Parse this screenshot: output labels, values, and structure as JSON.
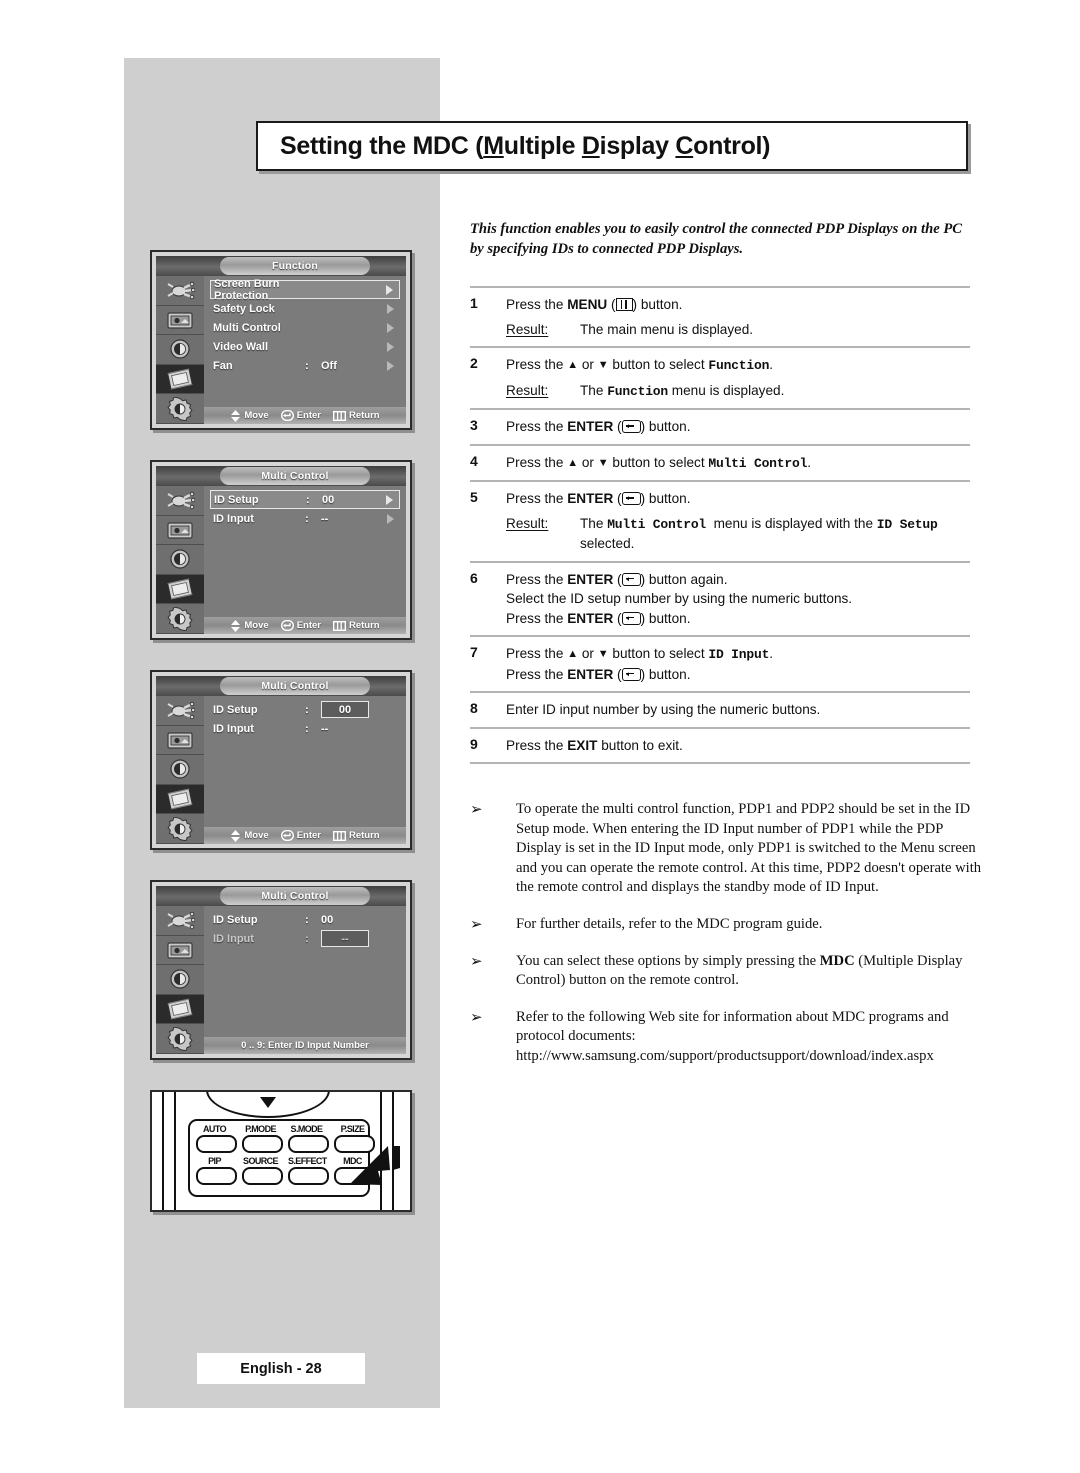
{
  "title": "Setting the MDC (Multiple Display Control)",
  "title_parts": [
    {
      "t": "Setting the MDC (",
      "u": false
    },
    {
      "t": "M",
      "u": true
    },
    {
      "t": "ultiple ",
      "u": false
    },
    {
      "t": "D",
      "u": true
    },
    {
      "t": "isplay ",
      "u": false
    },
    {
      "t": "C",
      "u": true
    },
    {
      "t": "ontrol)",
      "u": false
    }
  ],
  "intro": "This function enables you to easily control the connected PDP Displays on the PC by specifying IDs to connected PDP Displays.",
  "result_label": "Result:",
  "steps": [
    {
      "num": "1",
      "lines": [
        "Press the <b>MENU</b> (<span class='menu-glyph'><i></i><i></i></span>) button."
      ],
      "result": "The main menu is displayed."
    },
    {
      "num": "2",
      "lines": [
        "Press the <span class='arr'>▲</span> or <span class='arr'>▼</span> button to select <span class='mono'>Function</span>."
      ],
      "result": "The <span class='mono'>Function</span> menu is displayed."
    },
    {
      "num": "3",
      "lines": [
        "Press the <b>ENTER</b> (<span class='enter-glyph'></span>) button."
      ],
      "result": null
    },
    {
      "num": "4",
      "lines": [
        "Press the <span class='arr'>▲</span> or <span class='arr'>▼</span> button to select <span class='mono'>Multi Control</span>."
      ],
      "result": null
    },
    {
      "num": "5",
      "lines": [
        "Press the <b>ENTER</b> (<span class='enter-glyph'></span>) button."
      ],
      "result": "The <span class='mono'>Multi Control</span>&nbsp; menu is displayed with the <span class='mono'>ID Setup</span> selected."
    },
    {
      "num": "6",
      "lines": [
        "Press the <b>ENTER</b> (<span class='enter-glyph'></span>) button again.",
        "Select the ID setup number by using the numeric buttons.",
        "Press the <b>ENTER</b> (<span class='enter-glyph'></span>) button."
      ],
      "result": null
    },
    {
      "num": "7",
      "lines": [
        "Press the <span class='arr'>▲</span> or <span class='arr'>▼</span> button to select <span class='mono'>ID Input</span>.",
        "Press the <b>ENTER</b> (<span class='enter-glyph'></span>) button."
      ],
      "result": null
    },
    {
      "num": "8",
      "lines": [
        "Enter ID input number by using the numeric buttons."
      ],
      "result": null
    },
    {
      "num": "9",
      "lines": [
        "Press the <b>EXIT</b> button to exit."
      ],
      "result": null
    }
  ],
  "notes": [
    {
      "bullet": "➢",
      "html": "To operate the multi control function, PDP1 and PDP2 should be set in the ID Setup mode. When entering the ID Input number of PDP1 while the PDP Display is set in the ID Input mode, only PDP1 is switched to the Menu screen and you can operate the remote control. At this time, PDP2 doesn't operate with the remote control and displays the standby mode of ID Input."
    },
    {
      "bullet": "➢",
      "html": "For further details, refer to the MDC program guide."
    },
    {
      "bullet": "➢",
      "html": "You can select these options by simply pressing the <b>MDC</b> (Multiple Display Control) button on the remote control."
    },
    {
      "bullet": "➢",
      "html": "Refer to the following Web site for information about MDC programs and protocol documents: http://www.samsung.com/support/productsupport/download/index.aspx"
    }
  ],
  "osd_panels": [
    {
      "tab": "Function",
      "active_icon": 3,
      "items": [
        {
          "label": "Screen Burn Protection",
          "colon": "",
          "value": "",
          "selected": true,
          "arrow": true,
          "arrow_lit": true,
          "dim": false,
          "boxed": false
        },
        {
          "label": "Safety Lock",
          "colon": "",
          "value": "",
          "selected": false,
          "arrow": true,
          "arrow_lit": false,
          "dim": false,
          "boxed": false
        },
        {
          "label": "Multi Control",
          "colon": "",
          "value": "",
          "selected": false,
          "arrow": true,
          "arrow_lit": false,
          "dim": false,
          "boxed": false
        },
        {
          "label": "Video Wall",
          "colon": "",
          "value": "",
          "selected": false,
          "arrow": true,
          "arrow_lit": false,
          "dim": false,
          "boxed": false
        },
        {
          "label": "Fan",
          "colon": ":",
          "value": "Off",
          "selected": false,
          "arrow": true,
          "arrow_lit": false,
          "dim": false,
          "boxed": false
        }
      ],
      "footer": [
        "Move",
        "Enter",
        "Return"
      ],
      "footer_single": null
    },
    {
      "tab": "Multi Control",
      "active_icon": 3,
      "items": [
        {
          "label": "ID Setup",
          "colon": ":",
          "value": "00",
          "selected": true,
          "arrow": true,
          "arrow_lit": true,
          "dim": false,
          "boxed": false
        },
        {
          "label": "ID Input",
          "colon": ":",
          "value": "--",
          "selected": false,
          "arrow": true,
          "arrow_lit": false,
          "dim": false,
          "boxed": false
        }
      ],
      "footer": [
        "Move",
        "Enter",
        "Return"
      ],
      "footer_single": null
    },
    {
      "tab": "Multi Control",
      "active_icon": 3,
      "items": [
        {
          "label": "ID Setup",
          "colon": ":",
          "value": "00",
          "selected": false,
          "arrow": false,
          "arrow_lit": false,
          "dim": false,
          "boxed": true
        },
        {
          "label": "ID Input",
          "colon": ":",
          "value": "--",
          "selected": false,
          "arrow": false,
          "arrow_lit": false,
          "dim": false,
          "boxed": false
        }
      ],
      "footer": [
        "Move",
        "Enter",
        "Return"
      ],
      "footer_single": null
    },
    {
      "tab": "Multi Control",
      "active_icon": 3,
      "items": [
        {
          "label": "ID Setup",
          "colon": ":",
          "value": "00",
          "selected": false,
          "arrow": false,
          "arrow_lit": false,
          "dim": false,
          "boxed": false
        },
        {
          "label": "ID Input",
          "colon": ":",
          "value": "--",
          "selected": false,
          "arrow": false,
          "arrow_lit": false,
          "dim": true,
          "boxed": true
        }
      ],
      "footer": null,
      "footer_single": "0 .. 9: Enter ID Input Number"
    }
  ],
  "osd_icons": [
    "input-plug-icon",
    "picture-icon",
    "sound-speaker-icon",
    "function-chip-icon",
    "setup-gear-icon"
  ],
  "remote": {
    "buttons_row1": [
      "AUTO",
      "P.MODE",
      "S.MODE",
      "P.SIZE"
    ],
    "buttons_row2": [
      "PIP",
      "SOURCE",
      "S.EFFECT",
      "MDC"
    ],
    "highlight": "MDC"
  },
  "page_number": "English - 28"
}
